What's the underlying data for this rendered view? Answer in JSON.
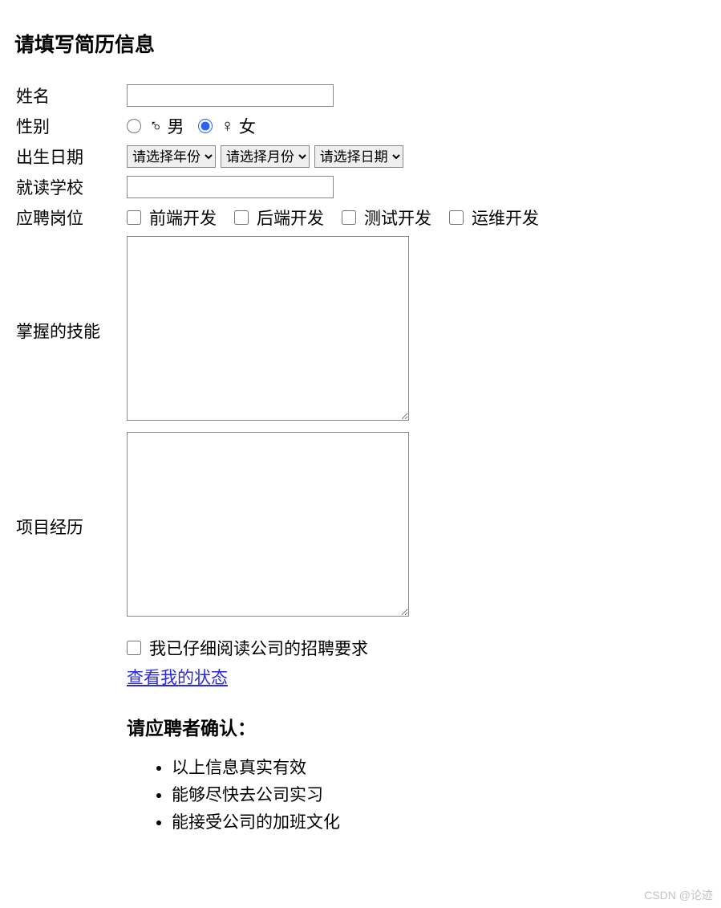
{
  "title": "请填写简历信息",
  "labels": {
    "name": "姓名",
    "gender": "性别",
    "birthdate": "出生日期",
    "school": "就读学校",
    "position": "应聘岗位",
    "skills": "掌握的技能",
    "projects": "项目经历"
  },
  "gender": {
    "male_label": "男",
    "female_label": "女",
    "male_checked": false,
    "female_checked": true
  },
  "birthdate": {
    "year_placeholder": "请选择年份",
    "month_placeholder": "请选择月份",
    "day_placeholder": "请选择日期"
  },
  "positions": [
    "前端开发",
    "后端开发",
    "测试开发",
    "运维开发"
  ],
  "values": {
    "name": "",
    "school": "",
    "skills": "",
    "projects": ""
  },
  "agree_label": "我已仔细阅读公司的招聘要求",
  "status_link": "查看我的状态",
  "confirm": {
    "heading": "请应聘者确认：",
    "items": [
      "以上信息真实有效",
      "能够尽快去公司实习",
      "能接受公司的加班文化"
    ]
  },
  "watermark": "CSDN @论迹"
}
